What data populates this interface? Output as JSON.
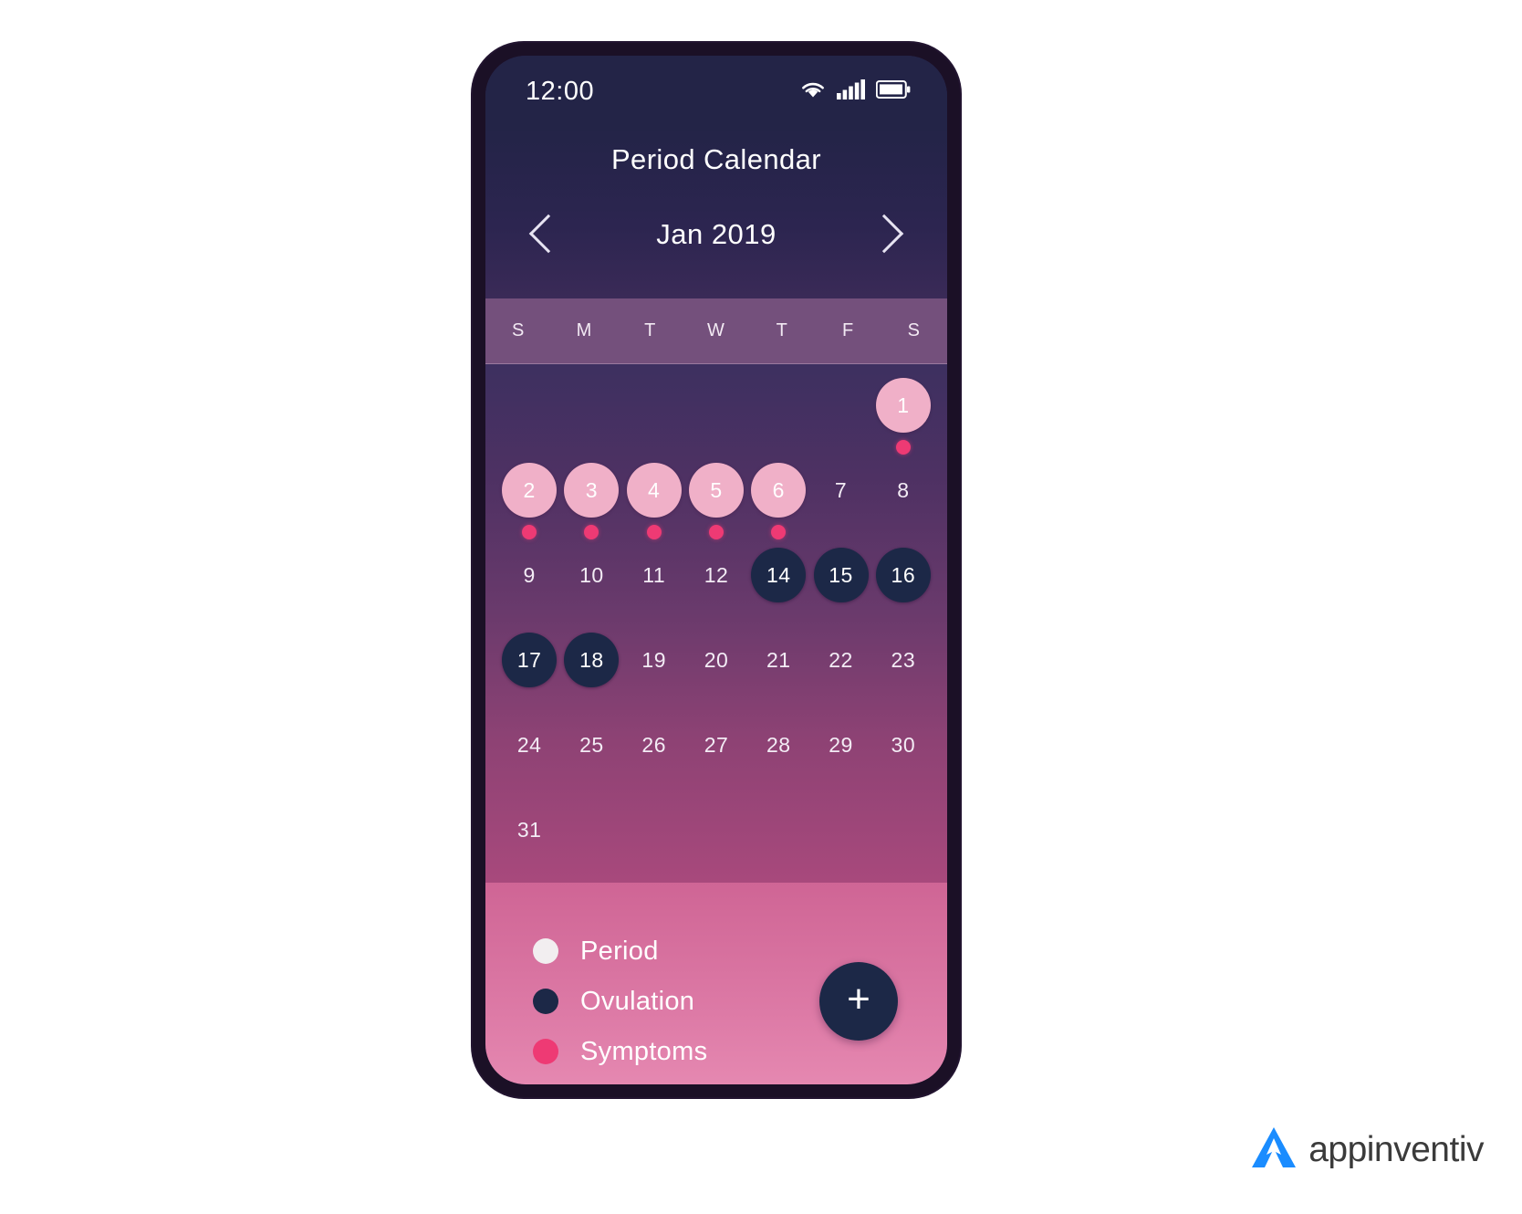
{
  "status_bar": {
    "time": "12:00",
    "icons": [
      "wifi-icon",
      "cellular-signal-icon",
      "battery-icon"
    ]
  },
  "header": {
    "app_title": "Period Calendar",
    "month_label": "Jan 2019",
    "prev_icon": "chevron-left-icon",
    "next_icon": "chevron-right-icon"
  },
  "weekdays": [
    "S",
    "M",
    "T",
    "W",
    "T",
    "F",
    "S"
  ],
  "calendar": {
    "leading_blanks": 6,
    "days": [
      {
        "label": "1",
        "type": "period",
        "symptom": true
      },
      {
        "label": "2",
        "type": "period",
        "symptom": true
      },
      {
        "label": "3",
        "type": "period",
        "symptom": true
      },
      {
        "label": "4",
        "type": "period",
        "symptom": true
      },
      {
        "label": "5",
        "type": "period",
        "symptom": true
      },
      {
        "label": "6",
        "type": "period",
        "symptom": true
      },
      {
        "label": "7",
        "type": "normal",
        "symptom": false
      },
      {
        "label": "8",
        "type": "normal",
        "symptom": false
      },
      {
        "label": "9",
        "type": "normal",
        "symptom": false
      },
      {
        "label": "10",
        "type": "normal",
        "symptom": false
      },
      {
        "label": "11",
        "type": "normal",
        "symptom": false
      },
      {
        "label": "12",
        "type": "normal",
        "symptom": false
      },
      {
        "label": "14",
        "type": "ovulation",
        "symptom": false
      },
      {
        "label": "15",
        "type": "ovulation",
        "symptom": false
      },
      {
        "label": "16",
        "type": "ovulation",
        "symptom": false
      },
      {
        "label": "17",
        "type": "ovulation",
        "symptom": false
      },
      {
        "label": "18",
        "type": "ovulation",
        "symptom": false
      },
      {
        "label": "19",
        "type": "normal",
        "symptom": false
      },
      {
        "label": "20",
        "type": "normal",
        "symptom": false
      },
      {
        "label": "21",
        "type": "normal",
        "symptom": false
      },
      {
        "label": "22",
        "type": "normal",
        "symptom": false
      },
      {
        "label": "23",
        "type": "normal",
        "symptom": false
      },
      {
        "label": "24",
        "type": "normal",
        "symptom": false
      },
      {
        "label": "25",
        "type": "normal",
        "symptom": false
      },
      {
        "label": "26",
        "type": "normal",
        "symptom": false
      },
      {
        "label": "27",
        "type": "normal",
        "symptom": false
      },
      {
        "label": "28",
        "type": "normal",
        "symptom": false
      },
      {
        "label": "29",
        "type": "normal",
        "symptom": false
      },
      {
        "label": "30",
        "type": "normal",
        "symptom": false
      },
      {
        "label": "31",
        "type": "normal",
        "symptom": false
      }
    ]
  },
  "legend": {
    "items": [
      {
        "label": "Period",
        "color": "#f2eef0"
      },
      {
        "label": "Ovulation",
        "color": "#1c2847"
      },
      {
        "label": "Symptoms",
        "color": "#ee3a74"
      }
    ],
    "add_button_glyph": "+"
  },
  "brand": {
    "name": "appinventiv",
    "logo_icon": "appinventiv-logo-icon",
    "logo_color": "#1a8cff"
  },
  "colors": {
    "period": "#f0b0c8",
    "ovulation": "#1c2847",
    "symptom": "#ee3a74",
    "header_bg": "#232447",
    "footer_bg": "#dd7aa6"
  }
}
